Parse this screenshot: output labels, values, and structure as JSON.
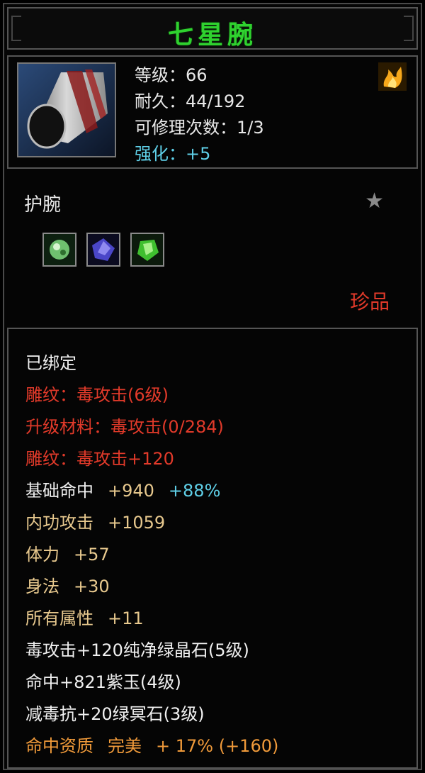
{
  "title": "七星腕",
  "stats": {
    "level": "等级：66",
    "durability": "耐久：44/192",
    "repairs": "可修理次数：1/3",
    "enhance": "强化：+5"
  },
  "item_type": "护腕",
  "rarity": "珍品",
  "gem_icons": [
    "green-gem-icon",
    "purple-gem-icon",
    "green-crystal-icon"
  ],
  "properties": {
    "bound": "已绑定",
    "engrave1": "雕纹：毒攻击(6级)",
    "upgrade_material": "升级材料：毒攻击(0/284)",
    "engrave2": "雕纹：毒攻击+120",
    "hit_label": "基础命中",
    "hit_value": "+940",
    "hit_percent": "+88%",
    "internal_label": "内功攻击",
    "internal_value": "+1059",
    "stamina_label": "体力",
    "stamina_value": "+57",
    "agility_label": "身法",
    "agility_value": "+30",
    "all_label": "所有属性",
    "all_value": "+11",
    "gem1": "毒攻击+120纯净绿晶石(5级)",
    "gem2": "命中+821紫玉(4级)",
    "gem3": "减毒抗+20绿冥石(3级)",
    "quality_label": "命中资质",
    "quality_grade": "完美",
    "quality_value": "+ 17% (+160)"
  },
  "colors": {
    "title": "#2fd22f",
    "red": "#e23a2a",
    "tan": "#e8c98e",
    "cyan": "#5fd0e8",
    "orange": "#f09a3a"
  }
}
